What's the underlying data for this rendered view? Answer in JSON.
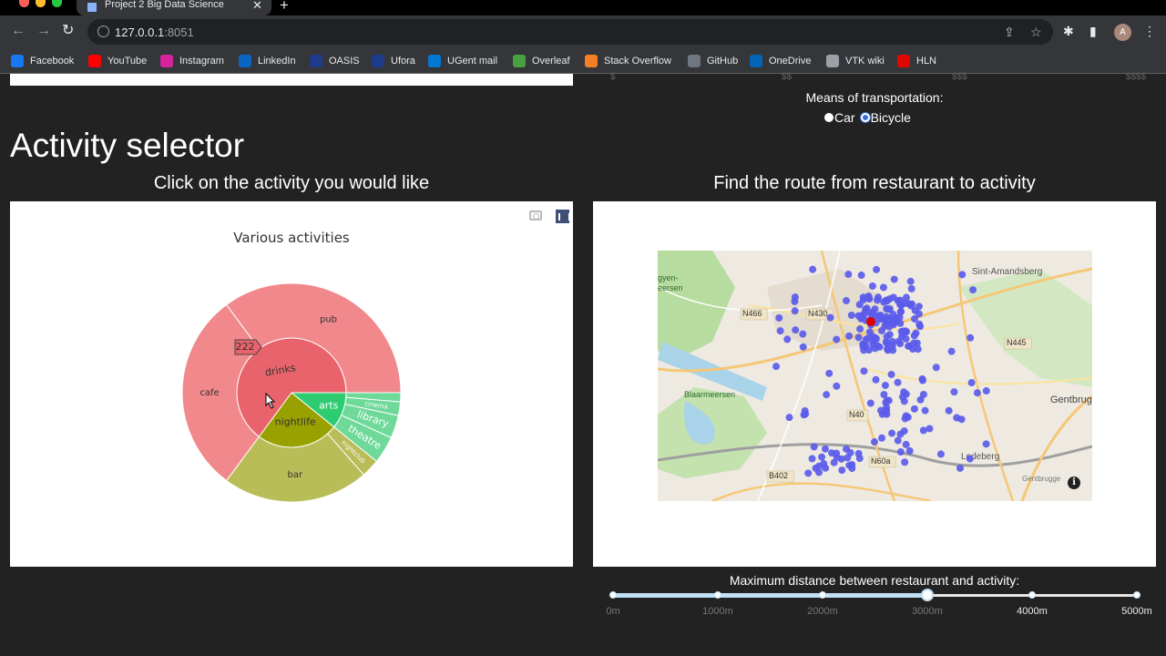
{
  "browser": {
    "tab_title": "Project 2 Big Data Science",
    "url_host": "127.0.0.1",
    "url_port": ":8051",
    "avatar_letter": "A",
    "bookmarks": [
      {
        "label": "Facebook",
        "color": "#1877f2",
        "icon": "facebook-icon"
      },
      {
        "label": "YouTube",
        "color": "#ff0000",
        "icon": "youtube-icon"
      },
      {
        "label": "Instagram",
        "color": "#d6249f",
        "icon": "instagram-icon"
      },
      {
        "label": "LinkedIn",
        "color": "#0a66c2",
        "icon": "linkedin-icon"
      },
      {
        "label": "OASIS",
        "color": "#1e3a8a",
        "icon": "oasis-icon"
      },
      {
        "label": "Ufora",
        "color": "#1e3a8a",
        "icon": "ufora-icon"
      },
      {
        "label": "UGent mail",
        "color": "#0078d4",
        "icon": "outlook-icon"
      },
      {
        "label": "Overleaf",
        "color": "#47a141",
        "icon": "overleaf-icon"
      },
      {
        "label": "Stack Overflow",
        "color": "#f48024",
        "icon": "stackoverflow-icon"
      },
      {
        "label": "GitHub",
        "color": "#6e7681",
        "icon": "github-icon"
      },
      {
        "label": "OneDrive",
        "color": "#0364b8",
        "icon": "onedrive-icon"
      },
      {
        "label": "VTK wiki",
        "color": "#9aa0a6",
        "icon": "vtk-icon"
      },
      {
        "label": "HLN",
        "color": "#e10600",
        "icon": "hln-icon"
      }
    ]
  },
  "price_ticks": [
    "$",
    "$$",
    "$$$",
    "$$$$"
  ],
  "transport": {
    "label": "Means of transportation:",
    "options": [
      "Car",
      "Bicycle"
    ],
    "selected": "Bicycle"
  },
  "activity": {
    "heading": "Activity selector",
    "subheading": "Click on the activity you would like"
  },
  "route": {
    "subheading": "Find the route from restaurant to activity"
  },
  "chart_data": {
    "type": "sunburst",
    "title": "Various activities",
    "hover_value": "222",
    "inner": [
      {
        "label": "drinks",
        "value": 48,
        "color": "#e8636b"
      },
      {
        "label": "nightlife",
        "value": 18,
        "color": "#98a100"
      },
      {
        "label": "arts",
        "value": 8,
        "color": "#2ecc71"
      }
    ],
    "outer": [
      {
        "label": "pub",
        "value": 26,
        "parent": "drinks",
        "color": "#f0888c"
      },
      {
        "label": "cafe",
        "value": 22,
        "parent": "drinks",
        "color": "#f0888c"
      },
      {
        "label": "bar",
        "value": 16,
        "parent": "nightlife",
        "color": "#b9bd58"
      },
      {
        "label": "nightclub",
        "value": 2,
        "parent": "nightlife",
        "color": "#b9bd58"
      },
      {
        "label": "theatre",
        "value": 3,
        "parent": "arts",
        "color": "#6fd99a"
      },
      {
        "label": "library",
        "value": 2.5,
        "parent": "arts",
        "color": "#6fd99a"
      },
      {
        "label": "cinema",
        "value": 1.5,
        "parent": "arts",
        "color": "#6fd99a"
      },
      {
        "label": "",
        "value": 1,
        "parent": "arts",
        "color": "#6fd99a"
      }
    ]
  },
  "map": {
    "labels": [
      "Sint-Amandsberg",
      "N466",
      "N430",
      "N445",
      "Gentbrugge",
      "Blaarmeersen",
      "N60a",
      "B402",
      "Ledeberg",
      "Gentbrugge",
      "gyen-",
      "eersen",
      "N40"
    ],
    "point_color": "#5b5bea",
    "selected_color": "#dd0000"
  },
  "slider": {
    "label": "Maximum distance between restaurant and activity:",
    "marks": [
      "0m",
      "1000m",
      "2000m",
      "3000m",
      "4000m",
      "5000m"
    ],
    "value_m": 3000,
    "max_m": 5000
  }
}
